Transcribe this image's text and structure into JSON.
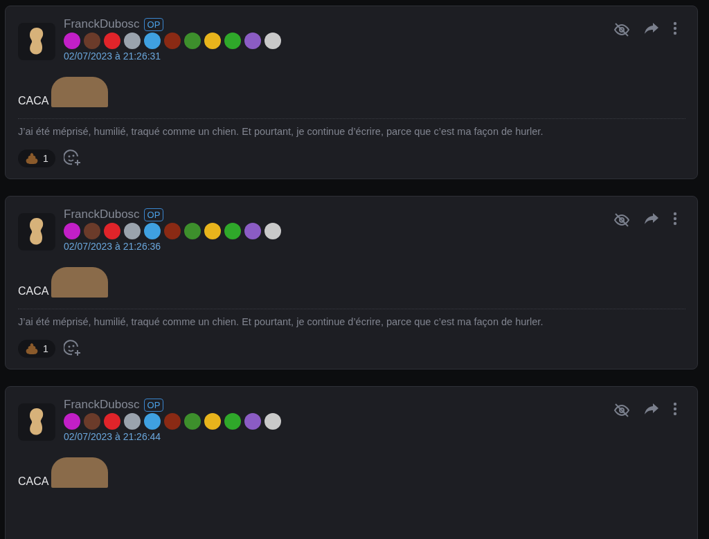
{
  "posts": [
    {
      "author": "FranckDubosc",
      "role_badge": "OP",
      "badges": [
        {
          "color": "#c21fc7"
        },
        {
          "color": "#6b3b2a"
        },
        {
          "color": "#e0242a"
        },
        {
          "color": "#9aa3ad"
        },
        {
          "color": "#3fa0e0"
        },
        {
          "color": "#8a2a14"
        },
        {
          "color": "#3d8f2c"
        },
        {
          "color": "#e8b41c"
        },
        {
          "color": "#2fa82a"
        },
        {
          "color": "#8b5cc4"
        },
        {
          "color": "#c9c9c9"
        }
      ],
      "timestamp": "02/07/2023 à 21:26:31",
      "body": "CACA",
      "signature": "J’ai été méprisé, humilié, traqué comme un chien. Et pourtant, je continue d’écrire, parce que c’est ma façon de hurler.",
      "reactions": [
        {
          "count": "1"
        }
      ]
    },
    {
      "author": "FranckDubosc",
      "role_badge": "OP",
      "badges": [
        {
          "color": "#c21fc7"
        },
        {
          "color": "#6b3b2a"
        },
        {
          "color": "#e0242a"
        },
        {
          "color": "#9aa3ad"
        },
        {
          "color": "#3fa0e0"
        },
        {
          "color": "#8a2a14"
        },
        {
          "color": "#3d8f2c"
        },
        {
          "color": "#e8b41c"
        },
        {
          "color": "#2fa82a"
        },
        {
          "color": "#8b5cc4"
        },
        {
          "color": "#c9c9c9"
        }
      ],
      "timestamp": "02/07/2023 à 21:26:36",
      "body": "CACA",
      "signature": "J’ai été méprisé, humilié, traqué comme un chien. Et pourtant, je continue d’écrire, parce que c’est ma façon de hurler.",
      "reactions": [
        {
          "count": "1"
        }
      ]
    },
    {
      "author": "FranckDubosc",
      "role_badge": "OP",
      "badges": [
        {
          "color": "#c21fc7"
        },
        {
          "color": "#6b3b2a"
        },
        {
          "color": "#e0242a"
        },
        {
          "color": "#9aa3ad"
        },
        {
          "color": "#3fa0e0"
        },
        {
          "color": "#8a2a14"
        },
        {
          "color": "#3d8f2c"
        },
        {
          "color": "#e8b41c"
        },
        {
          "color": "#2fa82a"
        },
        {
          "color": "#8b5cc4"
        },
        {
          "color": "#c9c9c9"
        }
      ],
      "timestamp": "02/07/2023 à 21:26:44",
      "body": "CACA"
    }
  ]
}
